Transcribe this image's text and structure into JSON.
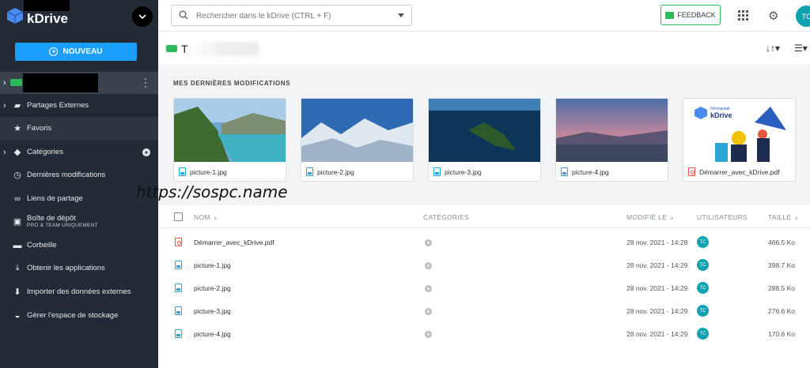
{
  "app": {
    "name": "kDrive"
  },
  "sidebar": {
    "new_button": "NOUVEAU",
    "items": [
      {
        "label": "Partages Externes"
      },
      {
        "label": "Favoris"
      },
      {
        "label": "Catégories"
      },
      {
        "label": "Dernières modifications"
      },
      {
        "label": "Liens de partage"
      },
      {
        "label": "Boîte de dépôt",
        "sub": "PRO & TEAM UNIQUEMENT"
      },
      {
        "label": "Corbeille"
      },
      {
        "label": "Obtenir les applications"
      },
      {
        "label": "Importer des données externes"
      },
      {
        "label": "Gérer l'espace de stockage"
      }
    ]
  },
  "topbar": {
    "search_placeholder": "Rechercher dans le kDrive (CTRL + F)",
    "feedback": "FEEDBACK",
    "avatar": "TC"
  },
  "header": {
    "title": "T"
  },
  "recent": {
    "title": "MES DERNIÈRES MODIFICATIONS",
    "cards": [
      {
        "name": "picture-1.jpg",
        "type": "image"
      },
      {
        "name": "picture-2.jpg",
        "type": "image"
      },
      {
        "name": "picture-3.jpg",
        "type": "image"
      },
      {
        "name": "picture-4.jpg",
        "type": "image"
      },
      {
        "name": "Démarrer_avec_kDrive.pdf",
        "type": "pdf",
        "thumb_brand": "kDrive",
        "thumb_sub": "Infomaniak"
      }
    ]
  },
  "watermark": "https://sospc.name",
  "table": {
    "headers": {
      "name": "NOM",
      "categories": "CATÉGORIES",
      "modified": "MODIFIÉ LE",
      "users": "UTILISATEURS",
      "size": "TAILLE"
    },
    "rows": [
      {
        "name": "Démarrer_avec_kDrive.pdf",
        "type": "pdf",
        "date": "28 nov. 2021 - 14:28",
        "user": "TC",
        "size": "466.5 Ko"
      },
      {
        "name": "picture-1.jpg",
        "type": "image",
        "date": "28 nov. 2021 - 14:29",
        "user": "TC",
        "size": "398.7 Ko"
      },
      {
        "name": "picture-2.jpg",
        "type": "image",
        "date": "28 nov. 2021 - 14:29",
        "user": "TC",
        "size": "288.5 Ko"
      },
      {
        "name": "picture-3.jpg",
        "type": "image",
        "date": "28 nov. 2021 - 14:29",
        "user": "TC",
        "size": "276.6 Ko"
      },
      {
        "name": "picture-4.jpg",
        "type": "image",
        "date": "28 nov. 2021 - 14:29",
        "user": "TC",
        "size": "170.6 Ko"
      }
    ]
  },
  "colors": {
    "sidebar": "#222a35",
    "accent": "#1a9fff",
    "green": "#2dba5a",
    "avatar": "#0fa3b1"
  }
}
